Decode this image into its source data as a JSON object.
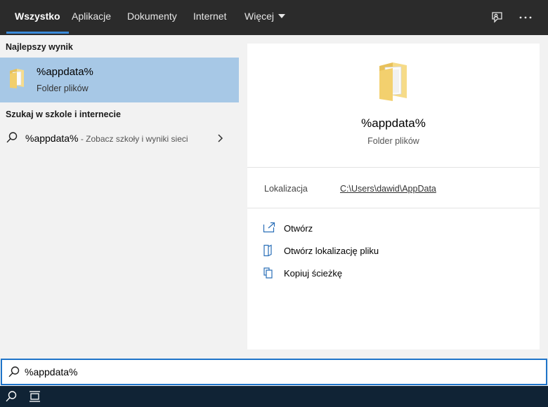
{
  "tabs": [
    {
      "label": "Wszystko",
      "active": true
    },
    {
      "label": "Aplikacje"
    },
    {
      "label": "Dokumenty"
    },
    {
      "label": "Internet"
    },
    {
      "label": "Więcej"
    }
  ],
  "header_icons": [
    "feedback-icon",
    "more-options-icon"
  ],
  "left": {
    "best_match_title": "Najlepszy wynik",
    "best_match": {
      "name": "%appdata%",
      "type": "Folder plików",
      "icon": "folder-icon"
    },
    "web_title": "Szukaj w szkole i internecie",
    "web_result": {
      "query": "%appdata%",
      "suffix": " - Zobacz szkoły i wyniki sieci"
    }
  },
  "preview": {
    "name": "%appdata%",
    "type": "Folder plików",
    "location_label": "Lokalizacja",
    "location_path": "C:\\Users\\dawid\\AppData",
    "actions": [
      {
        "label": "Otwórz",
        "icon": "open-icon"
      },
      {
        "label": "Otwórz lokalizację pliku",
        "icon": "open-file-location-icon"
      },
      {
        "label": "Kopiuj ścieżkę",
        "icon": "copy-path-icon"
      }
    ]
  },
  "search": {
    "value": "%appdata%"
  },
  "taskbar_icons": [
    "search-icon",
    "task-view-icon"
  ],
  "colors": {
    "accent": "#1e74c9",
    "selection": "#a7c8e6",
    "header": "#2b2b2b",
    "taskbar": "#102335"
  }
}
